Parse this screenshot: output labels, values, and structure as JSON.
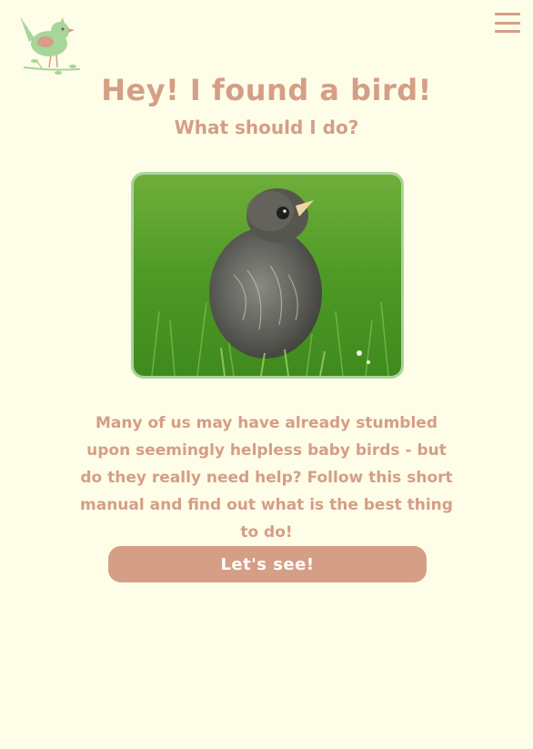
{
  "header": {
    "logo_icon": "bird-on-branch-icon",
    "menu_icon": "hamburger-menu-icon"
  },
  "hero": {
    "title": "Hey! I found a bird!",
    "subtitle": "What should I do?",
    "photo_subject": "baby-bird-in-grass"
  },
  "intro": {
    "text": "Many of us may have already stumbled upon seemingly helpless baby birds - but do they really need help? Follow this short manual and find out what is the best thing to do!"
  },
  "cta": {
    "label": "Let's see!"
  },
  "colors": {
    "background": "#fefde8",
    "accent": "#d59e86",
    "frame": "#a8d59a",
    "logo_bird": "#a8d59a",
    "button_text": "#ffffff"
  }
}
